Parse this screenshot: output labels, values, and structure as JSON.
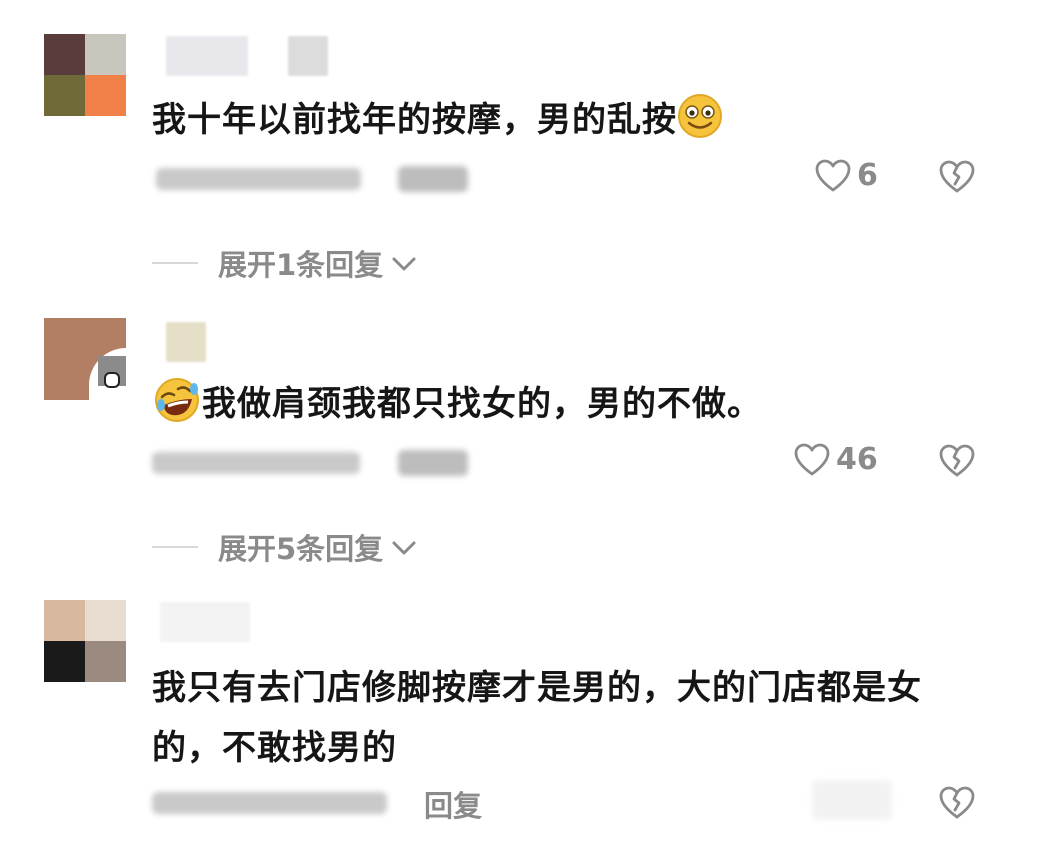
{
  "comments": [
    {
      "text": "我十年以前找年的按摩，男的乱按",
      "likes": "6",
      "expand_label": "展开1条回复",
      "emoji_after": "smiling-face"
    },
    {
      "text": "我做肩颈我都只找女的，男的不做。",
      "likes": "46",
      "expand_label": "展开5条回复",
      "emoji_before": "rolling-laughing-face"
    },
    {
      "text_line1": "我只有去门店修脚按摩才是男的，大的门店都是女",
      "text_line2": "的，不敢找男的",
      "reply_label": "回复"
    }
  ],
  "colors": {
    "text": "#161616",
    "meta": "#8a8a8a",
    "divider": "#d8d8d8"
  },
  "icons": [
    "heart-outline-icon",
    "broken-heart-icon",
    "chevron-down-icon"
  ]
}
